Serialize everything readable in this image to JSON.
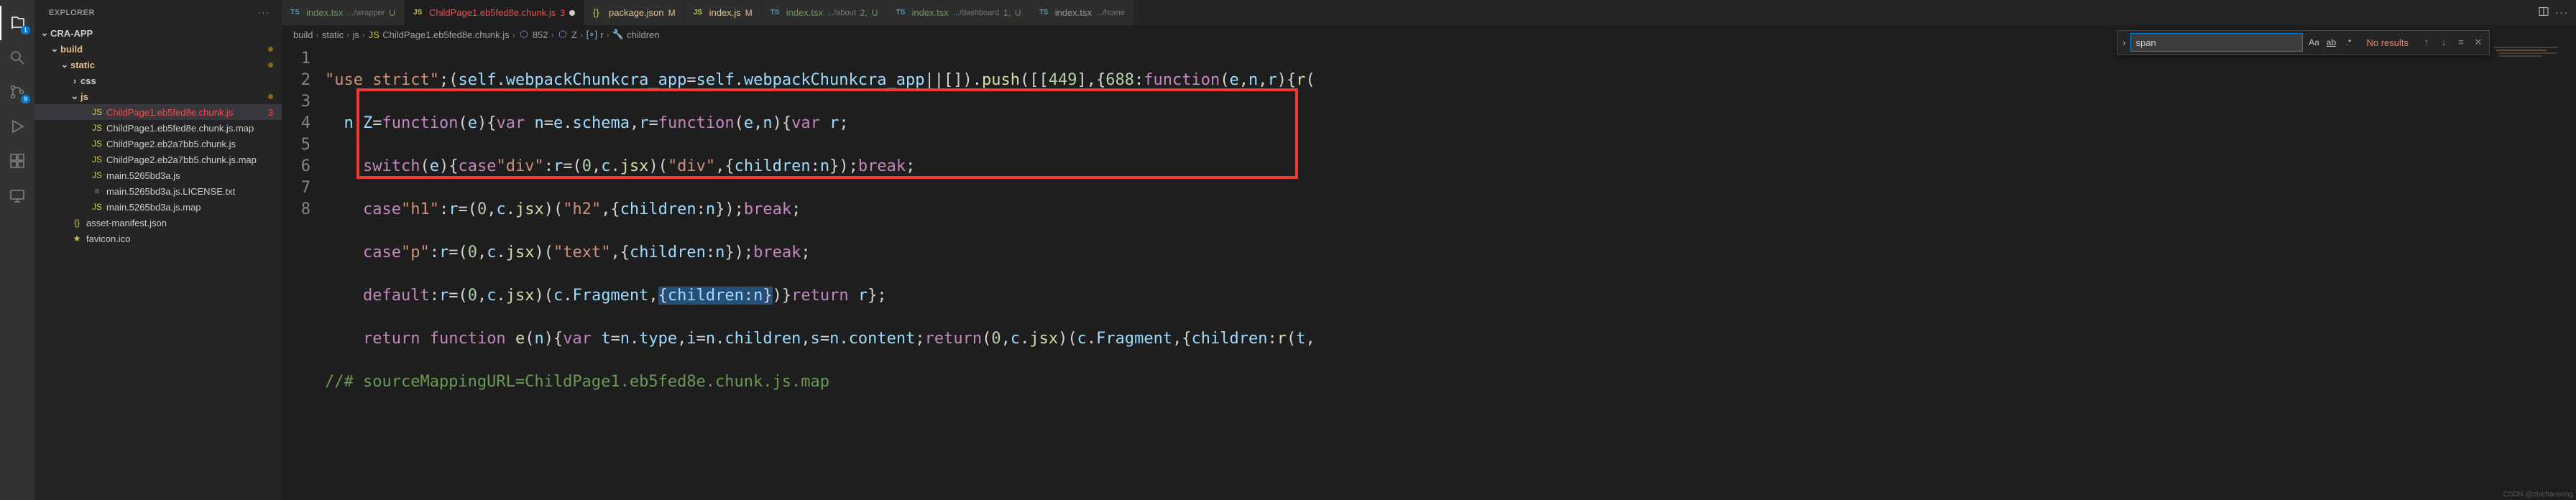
{
  "activity_bar": {
    "explorer_badge": "1",
    "scm_badge": "9"
  },
  "sidebar": {
    "title": "EXPLORER",
    "root": "CRA-APP",
    "tree": [
      {
        "label": "build",
        "depth": 1,
        "folder": true,
        "open": true,
        "git": "M"
      },
      {
        "label": "static",
        "depth": 2,
        "folder": true,
        "open": true,
        "git": "M"
      },
      {
        "label": "css",
        "depth": 3,
        "folder": true,
        "open": false
      },
      {
        "label": "js",
        "depth": 3,
        "folder": true,
        "open": true,
        "git": "M"
      },
      {
        "label": "ChildPage1.eb5fed8e.chunk.js",
        "depth": 4,
        "icon": "js",
        "active": true,
        "tail_num": "3",
        "err": true
      },
      {
        "label": "ChildPage1.eb5fed8e.chunk.js.map",
        "depth": 4,
        "icon": "js"
      },
      {
        "label": "ChildPage2.eb2a7bb5.chunk.js",
        "depth": 4,
        "icon": "js"
      },
      {
        "label": "ChildPage2.eb2a7bb5.chunk.js.map",
        "depth": 4,
        "icon": "js"
      },
      {
        "label": "main.5265bd3a.js",
        "depth": 4,
        "icon": "js"
      },
      {
        "label": "main.5265bd3a.js.LICENSE.txt",
        "depth": 4,
        "icon": "txt"
      },
      {
        "label": "main.5265bd3a.js.map",
        "depth": 4,
        "icon": "js"
      },
      {
        "label": "asset-manifest.json",
        "depth": 2,
        "icon": "json"
      },
      {
        "label": "favicon.ico",
        "depth": 2,
        "icon": "star"
      }
    ]
  },
  "tabs": [
    {
      "icon": "ts",
      "label": "index.tsx",
      "path": ".../wrapper",
      "git": "U",
      "git_class": "git-u"
    },
    {
      "icon": "js",
      "label": "ChildPage1.eb5fed8e.chunk.js",
      "badge": "3",
      "dirty": true,
      "active": true,
      "err": true
    },
    {
      "icon": "json",
      "label": "package.json",
      "git": "M",
      "git_class": "git-m"
    },
    {
      "icon": "js",
      "label": "index.js",
      "git": "M",
      "git_class": "git-m"
    },
    {
      "icon": "ts",
      "label": "index.tsx",
      "path": ".../about",
      "badge": "2,",
      "git": "U",
      "git_class": "git-u"
    },
    {
      "icon": "ts",
      "label": "index.tsx",
      "path": ".../dashboard",
      "badge": "1,",
      "git": "U",
      "git_class": "git-u"
    },
    {
      "icon": "ts",
      "label": "index.tsx",
      "path": ".../home"
    }
  ],
  "breadcrumbs": [
    "build",
    "static",
    "js",
    "ChildPage1.eb5fed8e.chunk.js",
    "852",
    "Z",
    "r",
    "children"
  ],
  "breadcrumb_icons": [
    "",
    "",
    "",
    "js",
    "cube",
    "cube",
    "brackets",
    "wrench"
  ],
  "search": {
    "value": "span",
    "no_results": "No results"
  },
  "code": {
    "lines": [
      1,
      2,
      3,
      4,
      5,
      6,
      7,
      8
    ],
    "l1": {
      "a": "\"use strict\"",
      "b": ";(",
      "c": "self",
      "d": ".",
      "e": "webpackChunkcra_app",
      "f": "=",
      "g": "self",
      "h": ".",
      "i": "webpackChunkcra_app",
      "j": "||[]).",
      "k": "push",
      "l": "([[",
      "m": "449",
      "n": "],{",
      "o": "688",
      "p": ":",
      "q": "function",
      "r": "(",
      "s": "e",
      "t": ",",
      "u": "n",
      "v": ",",
      "w": "r",
      "x": "){",
      "y": "r",
      "z": "("
    },
    "l2": {
      "a": "n",
      "b": ".",
      "c": "Z",
      "d": "=",
      "e": "function",
      "f": "(",
      "g": "e",
      "h": "){",
      "i": "var",
      "j": " ",
      "k": "n",
      "l": "=",
      "m": "e",
      "n": ".",
      "o": "schema",
      "p": ",",
      "q": "r",
      "r": "=",
      "s": "function",
      "t": "(",
      "u": "e",
      "v": ",",
      "w": "n",
      "x": "){",
      "y": "var",
      "z": " ",
      "aa": "r",
      "ab": ";"
    },
    "l3": {
      "a": "switch",
      "b": "(",
      "c": "e",
      "d": "){",
      "e": "case",
      "f": "\"div\"",
      "g": ":",
      "h": "r",
      "i": "=(",
      "j": "0",
      "k": ",",
      "l": "c",
      "m": ".",
      "n": "jsx",
      "o": ")(",
      "p": "\"div\"",
      "q": ",{",
      "r": "children",
      "s": ":",
      "t": "n",
      "u": "});",
      "v": "break",
      "w": ";"
    },
    "l4": {
      "a": "case",
      "b": "\"h1\"",
      "c": ":",
      "d": "r",
      "e": "=(",
      "f": "0",
      "g": ",",
      "h": "c",
      "i": ".",
      "j": "jsx",
      "k": ")(",
      "l": "\"h2\"",
      "m": ",{",
      "n": "children",
      "o": ":",
      "p": "n",
      "q": "});",
      "r": "break",
      "s": ";"
    },
    "l5": {
      "a": "case",
      "b": "\"p\"",
      "c": ":",
      "d": "r",
      "e": "=(",
      "f": "0",
      "g": ",",
      "h": "c",
      "i": ".",
      "j": "jsx",
      "k": ")(",
      "l": "\"text\"",
      "m": ",{",
      "n": "children",
      "o": ":",
      "p": "n",
      "q": "});",
      "r": "break",
      "s": ";"
    },
    "l6": {
      "a": "default",
      "b": ":",
      "c": "r",
      "d": "=(",
      "e": "0",
      "f": ",",
      "g": "c",
      "h": ".",
      "i": "jsx",
      "j": ")(",
      "k": "c",
      "l": ".",
      "m": "Fragment",
      "n": ",",
      "o": "{",
      "p": "children",
      "q": ":",
      "r": "n",
      "s": "}",
      "t": ")}",
      "u": "return",
      "v": " ",
      "w": "r",
      "x": "};"
    },
    "l7": {
      "a": "return",
      "b": " ",
      "c": "function",
      "d": " ",
      "e": "e",
      "f": "(",
      "g": "n",
      "h": "){",
      "i": "var",
      "j": " ",
      "k": "t",
      "l": "=",
      "m": "n",
      "n": ".",
      "o": "type",
      "p": ",",
      "q": "i",
      "r": "=",
      "s": "n",
      "t": ".",
      "u": "children",
      "v": ",",
      "w": "s",
      "x": "=",
      "y": "n",
      "z": ".",
      "aa": "content",
      "ab": ";",
      "ac": "return",
      "ad": "(",
      "ae": "0",
      "af": ",",
      "ag": "c",
      "ah": ".",
      "ai": "jsx",
      "aj": ")(",
      "ak": "c",
      "al": ".",
      "am": "Fragment",
      "an": ",{",
      "ao": "children",
      "ap": ":",
      "aq": "r",
      "ar": "(",
      "as": "t",
      "at": ","
    },
    "l8": {
      "a": "//# sourceMappingURL=ChildPage1.eb5fed8e.chunk.js.map"
    }
  },
  "watermark": "CSDN @zhichaosong"
}
